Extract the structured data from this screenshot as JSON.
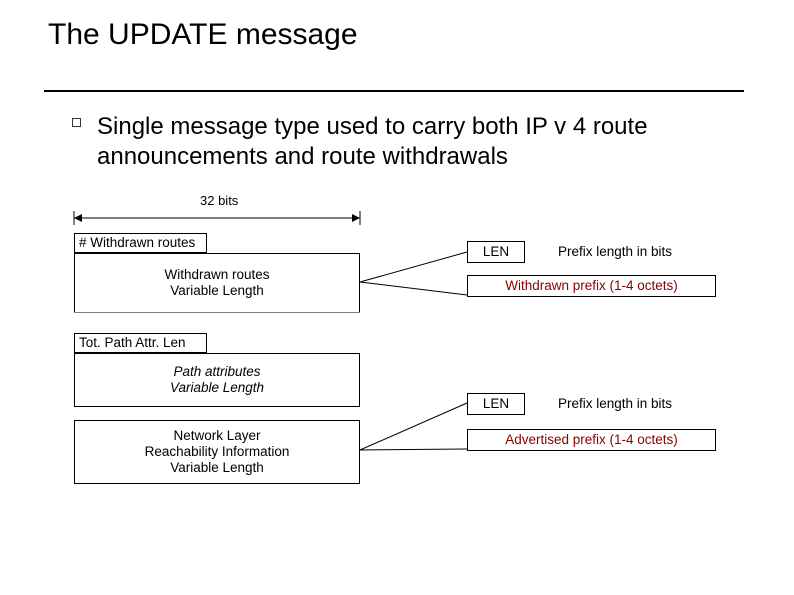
{
  "title": "The UPDATE message",
  "subtitle": "Single message type used to carry both IP v 4 route announcements and route withdrawals",
  "bits_label": "32 bits",
  "left": {
    "withdrawn_hdr": "# Withdrawn routes",
    "withdrawn_body": "Withdrawn routes\nVariable Length",
    "path_hdr": "Tot. Path Attr. Len",
    "path_body": "Path attributes\nVariable Length",
    "nlri": "Network Layer\nReachability Information\nVariable Length"
  },
  "right": {
    "len1": "LEN",
    "plen1": "Prefix length in bits",
    "wprefix": "Withdrawn prefix (1-4 octets)",
    "len2": "LEN",
    "plen2": "Prefix length in bits",
    "aprefix": "Advertised prefix (1-4 octets)"
  }
}
